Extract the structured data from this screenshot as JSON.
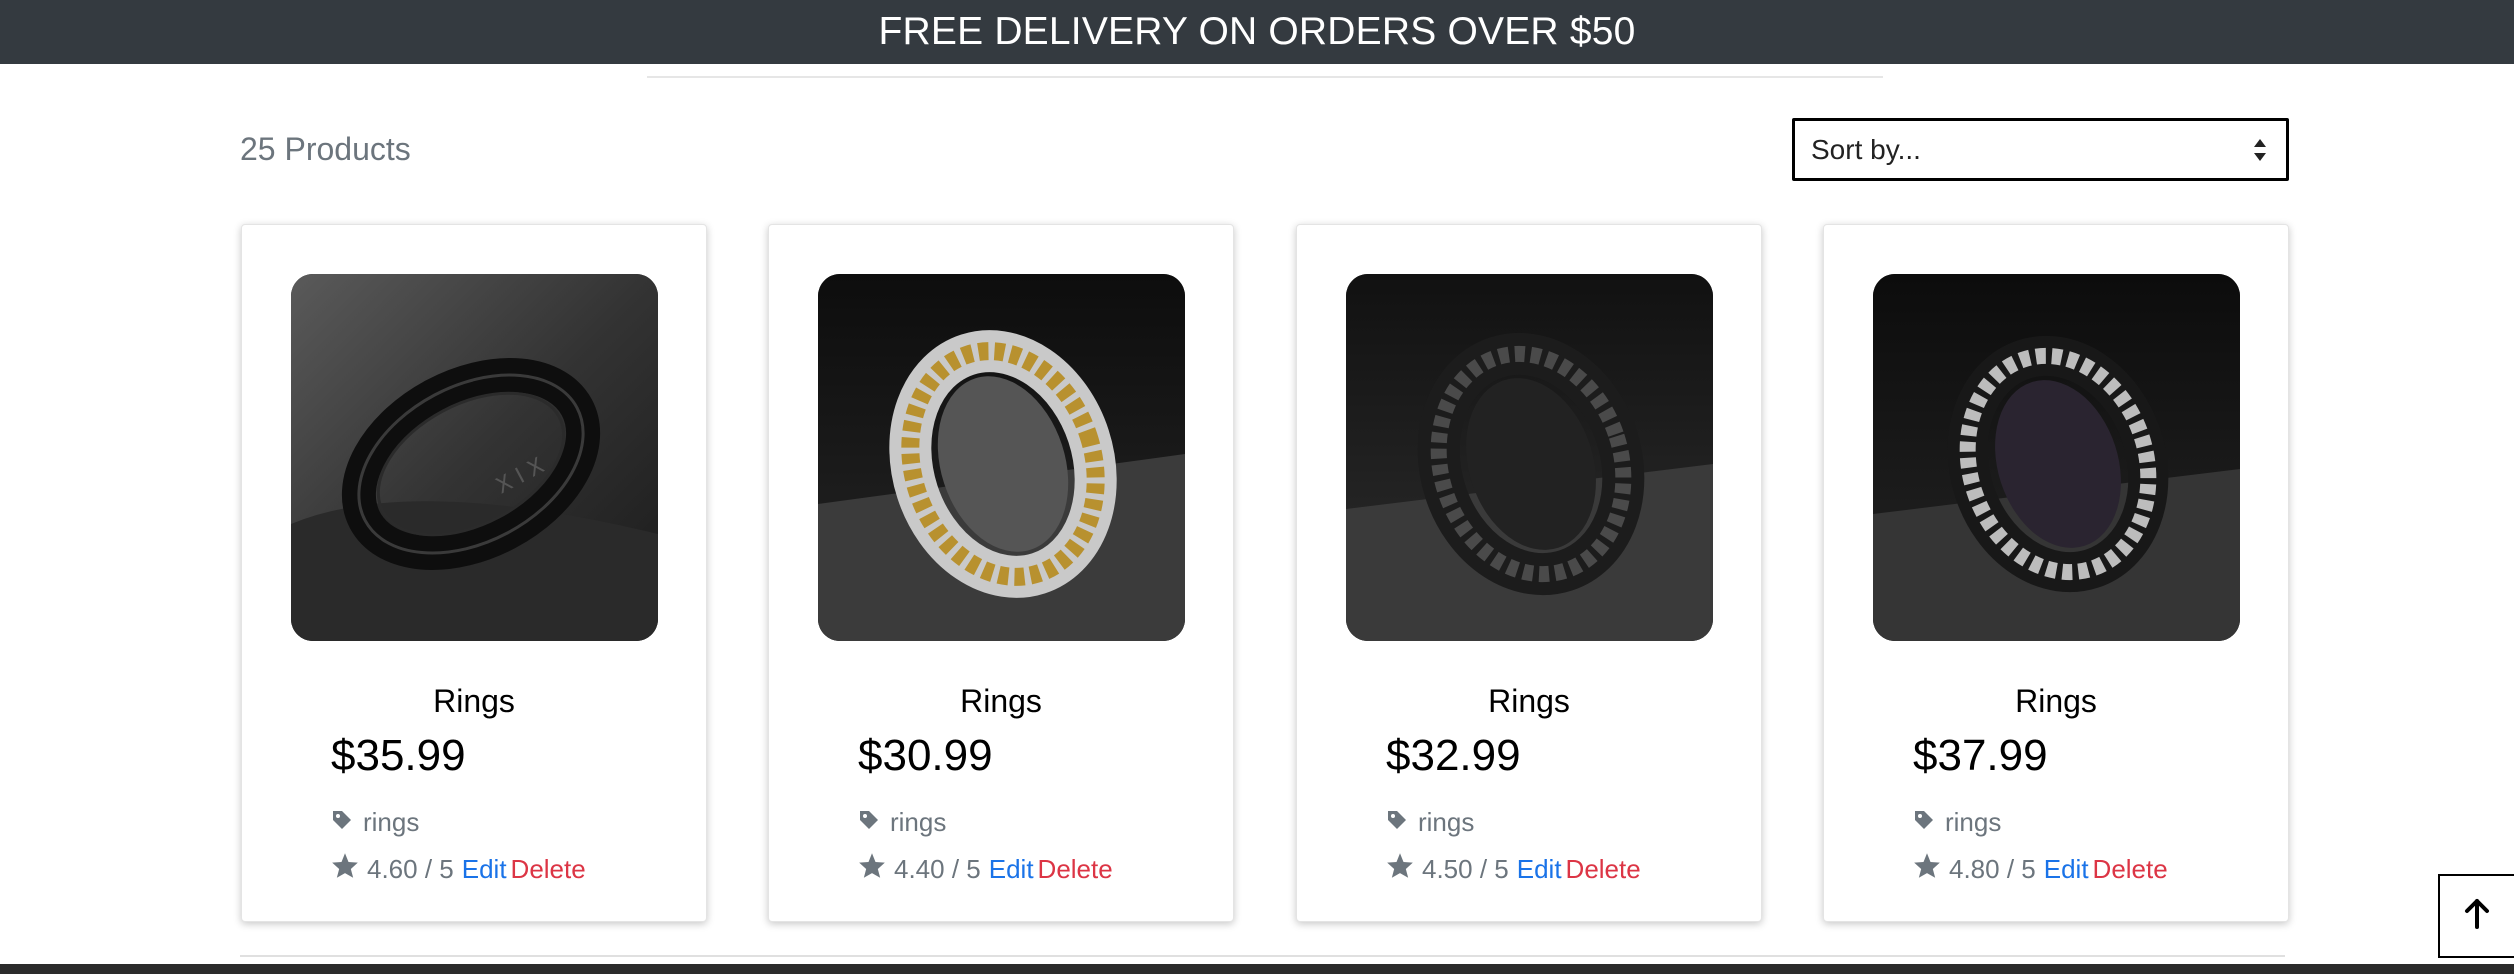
{
  "banner": {
    "text": "FREE DELIVERY ON ORDERS OVER $50"
  },
  "toolbar": {
    "product_count": "25 Products",
    "sort_value": "Sort by..."
  },
  "products": [
    {
      "title": "Rings",
      "price": "$35.99",
      "category": "rings",
      "rating": "4.60 / 5",
      "edit_label": "Edit",
      "delete_label": "Delete",
      "image": "black-roman-numeral-ring"
    },
    {
      "title": "Rings",
      "price": "$30.99",
      "category": "rings",
      "rating": "4.40 / 5",
      "edit_label": "Edit",
      "delete_label": "Delete",
      "image": "gold-chain-spinner-ring"
    },
    {
      "title": "Rings",
      "price": "$32.99",
      "category": "rings",
      "rating": "4.50 / 5",
      "edit_label": "Edit",
      "delete_label": "Delete",
      "image": "black-chain-spinner-ring"
    },
    {
      "title": "Rings",
      "price": "$37.99",
      "category": "rings",
      "rating": "4.80 / 5",
      "edit_label": "Edit",
      "delete_label": "Delete",
      "image": "silver-chain-black-ring"
    }
  ],
  "colors": {
    "banner_bg": "#343a40",
    "edit_link": "#1a73e8",
    "delete_link": "#dc3545",
    "muted_text": "#6c757d"
  },
  "icons": [
    "tag-icon",
    "star-icon",
    "sort-arrows-icon",
    "arrow-up-icon"
  ]
}
